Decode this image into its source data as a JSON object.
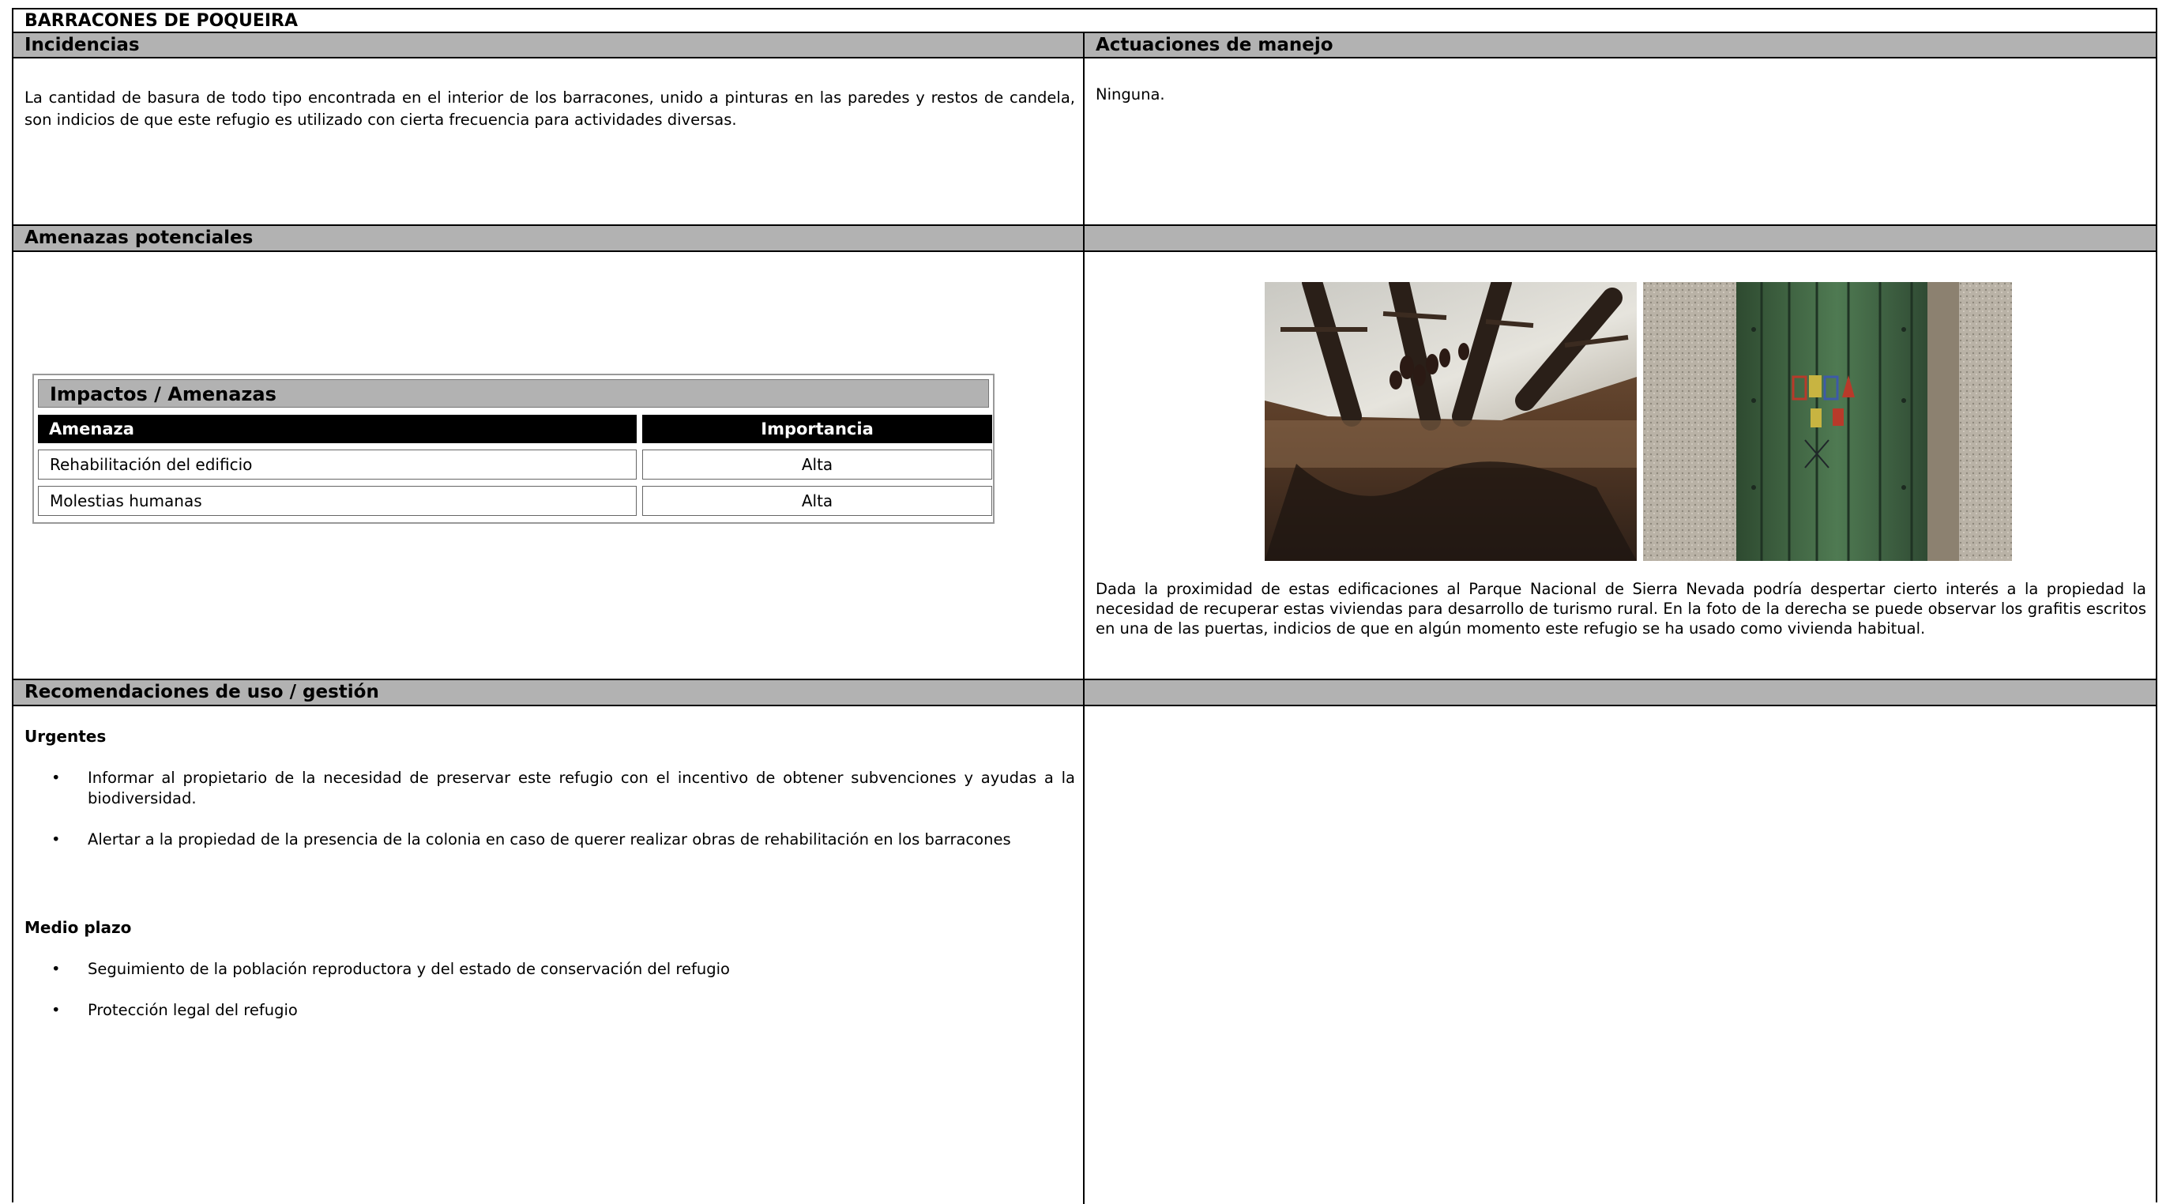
{
  "document": {
    "title": "BARRACONES DE POQUEIRA",
    "incidencias": {
      "header": "Incidencias",
      "text": "La cantidad de basura de todo tipo encontrada en el interior de los barracones, unido a pinturas en las paredes y restos de candela, son indicios de que este refugio es utilizado con cierta frecuencia para actividades diversas."
    },
    "actuaciones": {
      "header": "Actuaciones de manejo",
      "text": "Ninguna."
    },
    "amenazas": {
      "header": "Amenazas potenciales",
      "table": {
        "title": "Impactos / Amenazas",
        "col_amenaza": "Amenaza",
        "col_importancia": "Importancia",
        "rows": [
          {
            "amenaza": "Rehabilitación del edificio",
            "importancia": "Alta"
          },
          {
            "amenaza": "Molestias humanas",
            "importancia": "Alta"
          }
        ]
      },
      "photo_caption": "Dada la proximidad  de estas edificaciones al Parque Nacional de Sierra Nevada podría despertar cierto interés a la propiedad la necesidad de recuperar estas viviendas para desarrollo de turismo rural. En la foto de la derecha se puede observar los grafitis escritos en una de las puertas, indicios de que en algún momento este refugio se ha usado como vivienda habitual."
    },
    "recomendaciones": {
      "header": "Recomendaciones de uso / gestión",
      "urgentes_label": "Urgentes",
      "urgentes": [
        "Informar al propietario de la necesidad de preservar este refugio con el incentivo de obtener subvenciones y ayudas a la biodiversidad.",
        " Alertar a la propiedad de la presencia de la colonia en caso de querer realizar obras de rehabilitación en los barracones"
      ],
      "medio_label": "Medio plazo",
      "medio": [
        "Seguimiento de la población reproductora y del estado de conservación del refugio",
        "Protección legal del refugio"
      ],
      "bullet": "•"
    }
  }
}
